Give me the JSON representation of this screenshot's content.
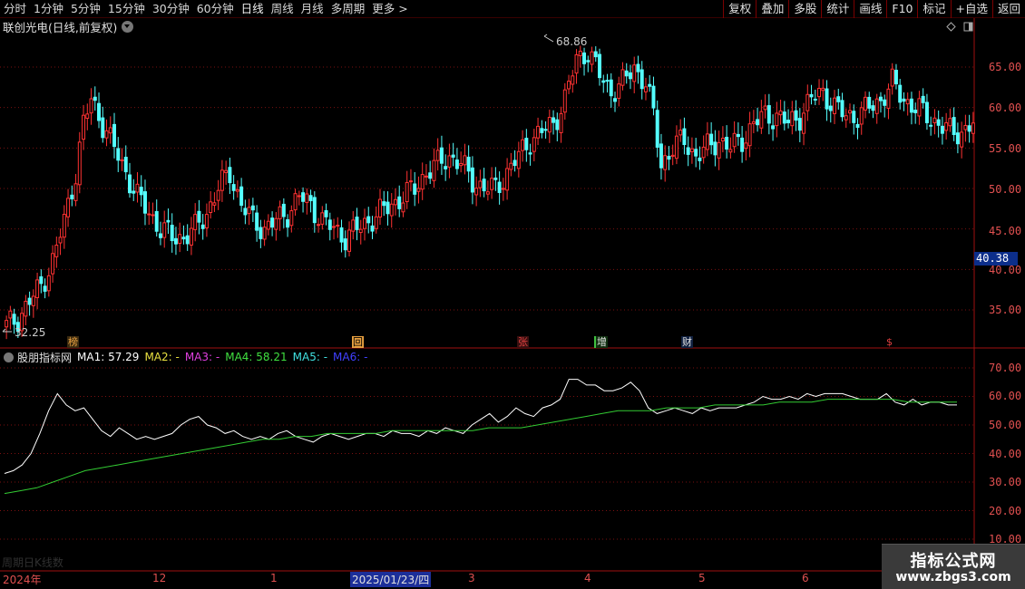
{
  "toolbar": {
    "periods": [
      "分时",
      "1分钟",
      "5分钟",
      "15分钟",
      "30分钟",
      "60分钟",
      "日线",
      "周线",
      "月线",
      "多周期",
      "更多"
    ],
    "more_arrow": ">",
    "buttons": [
      "复权",
      "叠加",
      "多股",
      "统计",
      "画线",
      "F10",
      "标记",
      "+自选",
      "返回"
    ]
  },
  "stock": {
    "title": "联创光电(日线,前复权)"
  },
  "price_axis": {
    "labels": [
      "65.00",
      "60.00",
      "55.00",
      "50.00",
      "45.00",
      "40.00",
      "35.00"
    ]
  },
  "price_tag": "40.38",
  "annotations": {
    "high": "68.86",
    "low": "32.25"
  },
  "markers": [
    {
      "text": "榜",
      "color": "#e8a040"
    },
    {
      "text": "回",
      "color": "#e8a040"
    },
    {
      "text": "张",
      "color": "#e04040"
    },
    {
      "text": "增",
      "color": "#40c040"
    },
    {
      "text": "财",
      "color": "#4080ff"
    },
    {
      "text": "$",
      "color": "#e04040"
    }
  ],
  "indicator": {
    "name": "股朋指标网",
    "ma1": "MA1: 57.29",
    "ma2": "MA2: -",
    "ma3": "MA3: -",
    "ma4": "MA4: 58.21",
    "ma5": "MA5: -",
    "ma6": "MA6: -",
    "colors": {
      "ma1": "#ffffff",
      "ma2": "#e8e040",
      "ma3": "#e040e0",
      "ma4": "#40e040",
      "ma5": "#40e0e0",
      "ma6": "#4040ff"
    }
  },
  "ind_axis": {
    "labels": [
      "70.00",
      "60.00",
      "50.00",
      "40.00",
      "30.00",
      "20.00",
      "10.00"
    ]
  },
  "date_axis": {
    "labels": [
      "2024年",
      "12",
      "1",
      "2025/01/23/四",
      "3",
      "4",
      "5",
      "6"
    ]
  },
  "watermark": {
    "title": "指标公式网",
    "url": "www.zbgs3.com"
  },
  "faded_text": "周期日K线数",
  "chart_data": {
    "type": "candlestick",
    "title": "联创光电(日线,前复权)",
    "y_range": [
      31,
      69
    ],
    "high": 68.86,
    "low": 32.25,
    "last_price_tag": 40.38,
    "indicator": {
      "type": "line",
      "y_range": [
        8,
        74
      ],
      "series": [
        {
          "name": "MA1",
          "values": [
            33,
            34,
            36,
            40,
            47,
            55,
            61,
            57,
            55,
            56,
            52,
            48,
            46,
            49,
            47,
            45,
            46,
            45,
            46,
            47,
            50,
            52,
            53,
            50,
            49,
            47,
            48,
            46,
            45,
            46,
            45,
            47,
            48,
            46,
            45,
            44,
            46,
            47,
            46,
            45,
            46,
            47,
            47,
            46,
            48,
            47,
            47,
            46,
            48,
            47,
            49,
            48,
            47,
            50,
            52,
            54,
            51,
            53,
            56,
            54,
            53,
            56,
            57,
            59,
            66,
            66,
            64,
            64,
            62,
            62,
            63,
            65,
            62,
            56,
            54,
            55,
            56,
            55,
            54,
            56,
            55,
            56,
            56,
            56,
            57,
            58,
            60,
            59,
            59,
            60,
            59,
            61,
            60,
            61,
            61,
            61,
            60,
            59,
            59,
            59,
            61,
            58,
            57,
            59,
            57,
            58,
            58,
            57,
            57
          ]
        },
        {
          "name": "MA4",
          "values": [
            26,
            27,
            28,
            30,
            32,
            34,
            35,
            36,
            37,
            38,
            39,
            40,
            41,
            42,
            43,
            44,
            45,
            45,
            46,
            46,
            47,
            47,
            47,
            47,
            48,
            48,
            48,
            48,
            48,
            48,
            49,
            49,
            49,
            50,
            51,
            52,
            53,
            54,
            55,
            55,
            55,
            56,
            56,
            56,
            57,
            57,
            57,
            57,
            58,
            58,
            58,
            59,
            59,
            59,
            59,
            59,
            58,
            58,
            58,
            58
          ]
        }
      ]
    }
  }
}
